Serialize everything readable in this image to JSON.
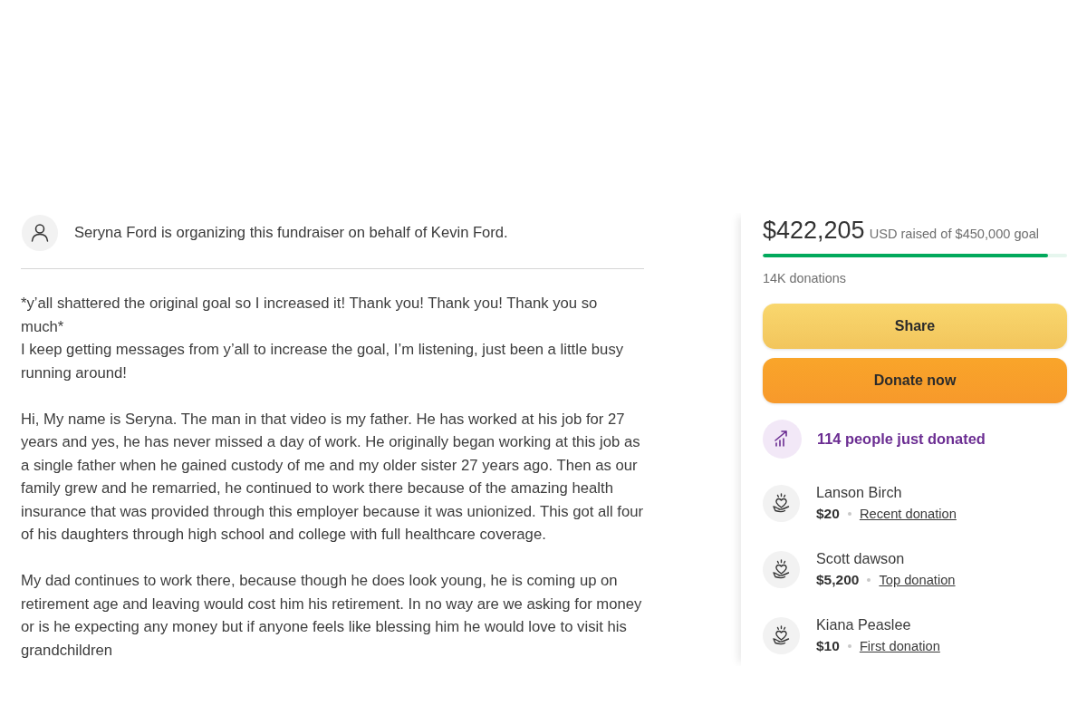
{
  "organizer": {
    "text": "Seryna Ford is organizing this fundraiser on behalf of Kevin Ford."
  },
  "story": [
    {
      "lines": [
        "*y’all shattered the original goal so I increased it! Thank you! Thank you! Thank you so much*",
        "I keep getting messages from y’all to increase the goal, I’m listening, just been a little busy running around!"
      ]
    },
    {
      "lines": [
        "Hi, My name is Seryna. The man in that video is my father. He has worked at his job for 27 years and yes, he has never missed a day of work. He originally began working at this job as a single father when he gained custody of me and my older sister 27 years ago. Then as our family grew and he remarried, he continued to work there because of the amazing health insurance that was provided through this employer because it was unionized. This got all four of his daughters through high school and college with full healthcare coverage."
      ]
    },
    {
      "lines": [
        "My dad continues to work there, because though he does look young, he is coming up on retirement age and leaving would cost him his retirement. In no way are we asking for money or is he expecting any money but if anyone feels like blessing him he would love to visit his grandchildren"
      ]
    }
  ],
  "progress": {
    "raised": "$422,205",
    "goal_text": "USD raised of $450,000 goal",
    "level": 0.938,
    "donations": "14K donations"
  },
  "buttons": [
    {
      "label": "Share",
      "kind": "share"
    },
    {
      "label": "Donate now",
      "kind": "donate"
    }
  ],
  "activity": {
    "text": "114 people just donated"
  },
  "donors": [
    {
      "name": "Lanson Birch",
      "amount": "$20",
      "tag": "Recent donation"
    },
    {
      "name": "Scott dawson",
      "amount": "$5,200",
      "tag": "Top donation"
    },
    {
      "name": "Kiana Peaslee",
      "amount": "$10",
      "tag": "First donation"
    }
  ]
}
